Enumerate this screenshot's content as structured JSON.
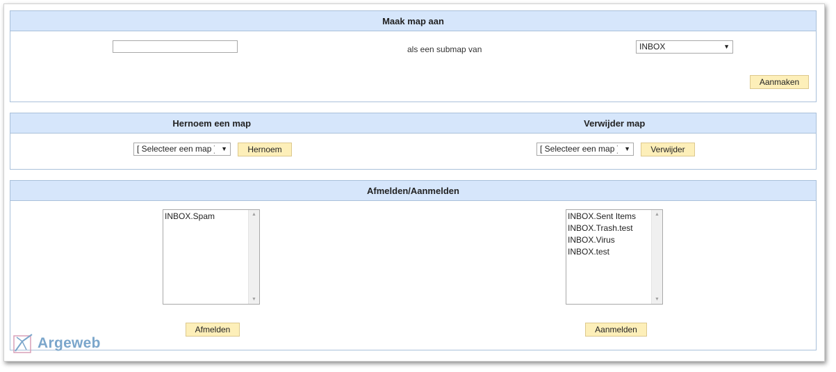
{
  "create": {
    "title": "Maak map aan",
    "name_value": "",
    "subfolder_label": "als een submap van",
    "parent_select": "INBOX",
    "create_button": "Aanmaken"
  },
  "rename": {
    "title": "Hernoem een map",
    "select": "[ Selecteer een map ]",
    "button": "Hernoem"
  },
  "delete": {
    "title": "Verwijder map",
    "select": "[ Selecteer een map ]",
    "button": "Verwijder"
  },
  "subscribe": {
    "title": "Afmelden/Aanmelden",
    "subscribed": [
      "INBOX.Spam"
    ],
    "unsubscribed": [
      "INBOX.Sent Items",
      "INBOX.Trash.test",
      "INBOX.Virus",
      "INBOX.test"
    ],
    "unsubscribe_button": "Afmelden",
    "subscribe_button": "Aanmelden"
  },
  "logo": {
    "text": "Argeweb"
  },
  "colors": {
    "header_bg": "#d6e6fb",
    "border": "#a9c0da",
    "button_bg": "#fdefb9",
    "logo": "#7ba6cb"
  }
}
